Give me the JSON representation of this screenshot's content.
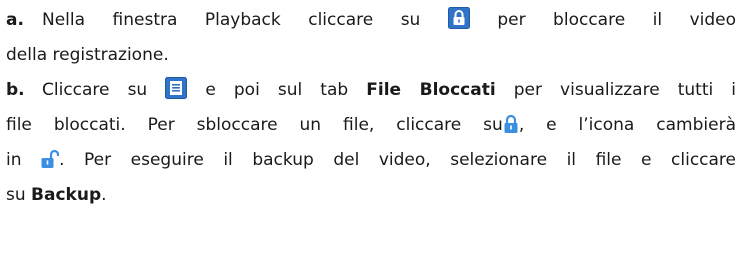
{
  "steps": [
    {
      "marker": "a.",
      "text_1": "Nella finestra Playback cliccare su",
      "text_2": "per bloccare il video",
      "text_3": "della registrazione."
    },
    {
      "marker": "b.",
      "text_1": "Cliccare su",
      "text_2": "e poi sul tab",
      "bold_tab": "File Bloccati",
      "text_3": "per visualizzare tutti i",
      "text_4": "file bloccati. Per sbloccare un file, cliccare su",
      "text_5": ", e l’icona cambierà",
      "text_6": "in",
      "text_7": ". Per eseguire il backup del video, selezionare il file e cliccare",
      "text_8": "su",
      "bold_backup": "Backup",
      "text_9": "."
    }
  ],
  "icons": {
    "lock_button": "lock-button-icon",
    "file_list_button": "file-list-button-icon",
    "locked_file": "locked-padlock-icon",
    "unlocked_file": "unlocked-padlock-icon"
  },
  "colors": {
    "text": "#1a1a1a",
    "button_blue": "#2f74c8",
    "padlock_blue": "#3a8fe0"
  }
}
